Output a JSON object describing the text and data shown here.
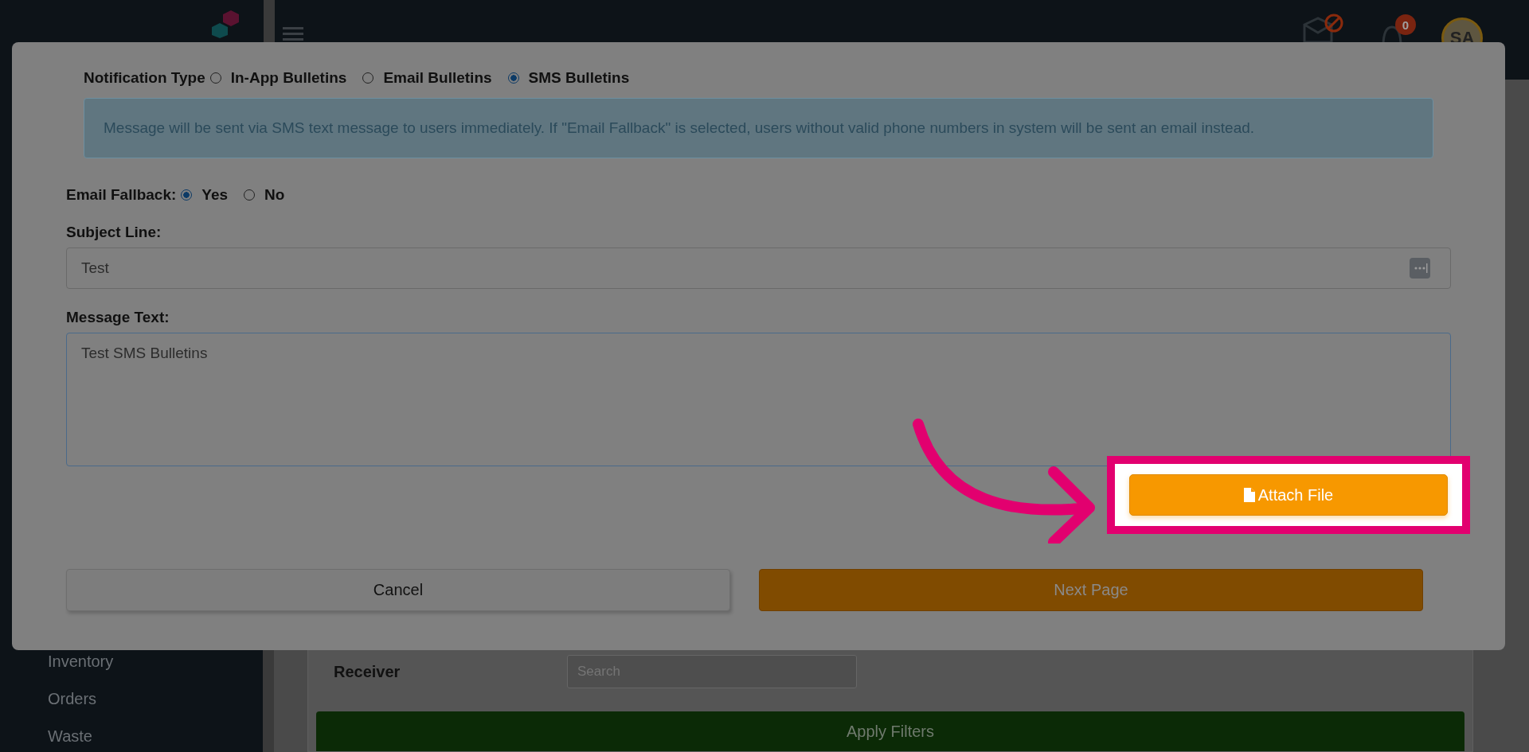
{
  "header": {
    "notifications_badge": "0",
    "avatar": "SA"
  },
  "sidebar": {
    "items": [
      "Inventory",
      "Orders",
      "Waste"
    ]
  },
  "filters": {
    "label": "Receiver",
    "search_placeholder": "Search",
    "apply_button": "Apply Filters"
  },
  "modal": {
    "notification_type": {
      "label": "Notification Type",
      "options": [
        {
          "label": "In-App Bulletins",
          "selected": false
        },
        {
          "label": "Email Bulletins",
          "selected": false
        },
        {
          "label": "SMS Bulletins",
          "selected": true
        }
      ]
    },
    "info": "Message will be sent via SMS text message to users immediately. If \"Email Fallback\" is selected, users without valid phone numbers in system will be sent an email instead.",
    "email_fallback": {
      "label": "Email Fallback:",
      "options": [
        {
          "label": "Yes",
          "selected": true
        },
        {
          "label": "No",
          "selected": false
        }
      ]
    },
    "subject": {
      "label": "Subject Line:",
      "value": "Test"
    },
    "message": {
      "label": "Message Text:",
      "value": "Test SMS Bulletins"
    },
    "attach_button": "Attach File",
    "cancel_button": "Cancel",
    "next_button": "Next Page"
  }
}
